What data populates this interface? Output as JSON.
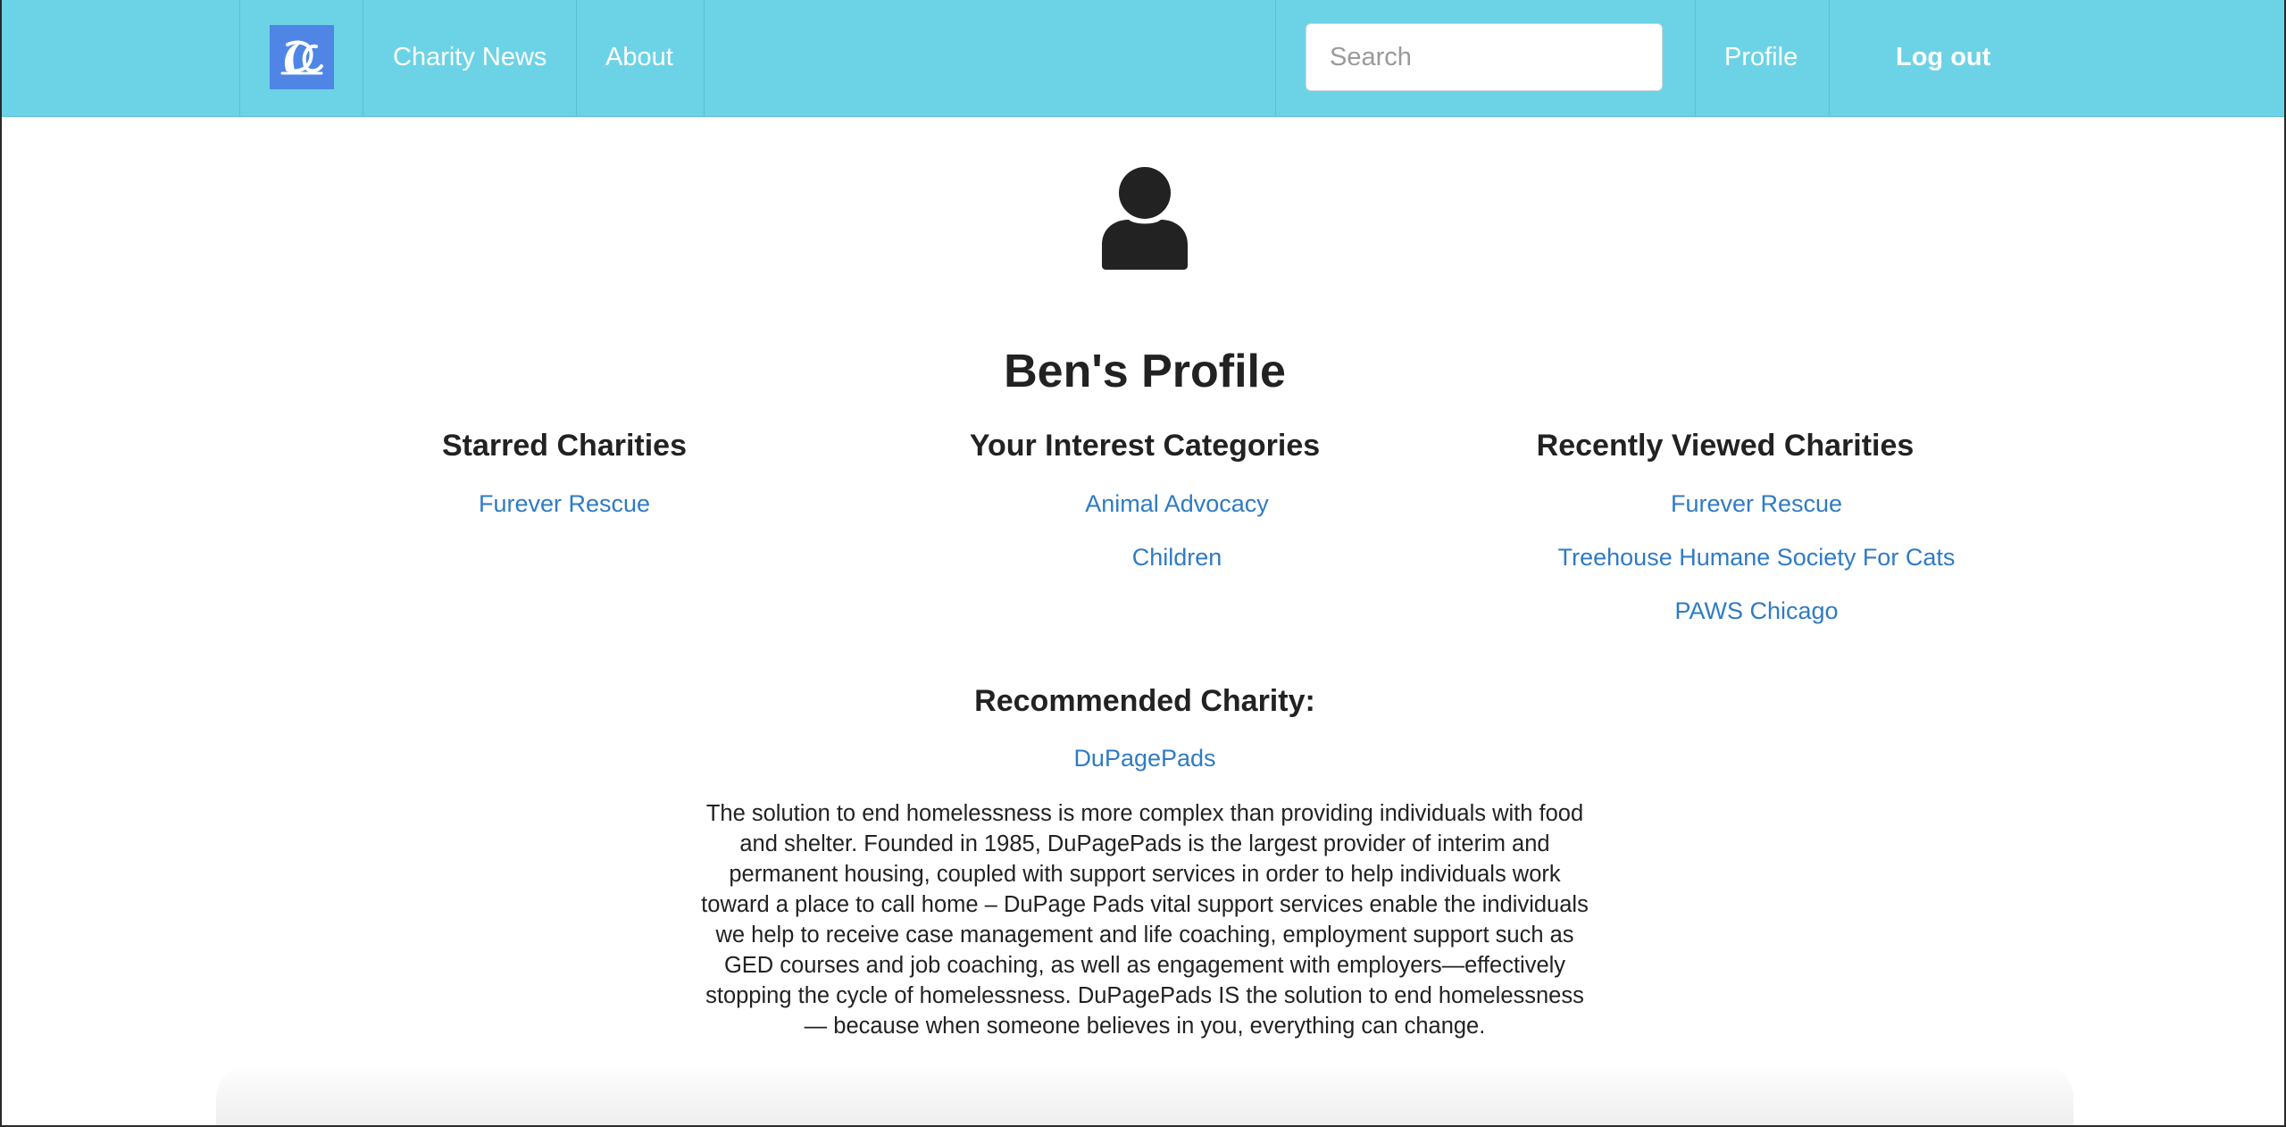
{
  "navbar": {
    "logo_alt": "DC",
    "links": {
      "charity_news": "Charity News",
      "about": "About",
      "profile": "Profile",
      "logout": "Log out"
    },
    "search": {
      "placeholder": "Search",
      "value": ""
    },
    "colors": {
      "background": "#6cd3e6",
      "logo_background": "#4f86e6"
    }
  },
  "profile": {
    "avatar_icon": "user-icon",
    "title": "Ben's Profile"
  },
  "starred": {
    "heading": "Starred Charities",
    "items": [
      "Furever Rescue"
    ]
  },
  "interests": {
    "heading": "Your Interest Categories",
    "items": [
      "Animal Advocacy",
      "Children"
    ]
  },
  "recent": {
    "heading": "Recently Viewed Charities",
    "items": [
      "Furever Rescue",
      "Treehouse Humane Society For Cats",
      "PAWS Chicago"
    ]
  },
  "recommended": {
    "heading": "Recommended Charity:",
    "name": "DuPagePads",
    "description": "The solution to end homelessness is more complex than providing individuals with food and shelter. Founded in 1985, DuPagePads is the largest provider of interim and permanent housing, coupled with support services in order to help individuals work toward a place to call home – DuPage Pads vital support services enable the individuals we help to receive case management and life coaching, employment support such as GED courses and job coaching, as well as engagement with employers—effectively stopping the cycle of homelessness. DuPagePads IS the solution to end homelessness — because when someone believes in you, everything can change."
  },
  "link_color": "#2f7bc4"
}
